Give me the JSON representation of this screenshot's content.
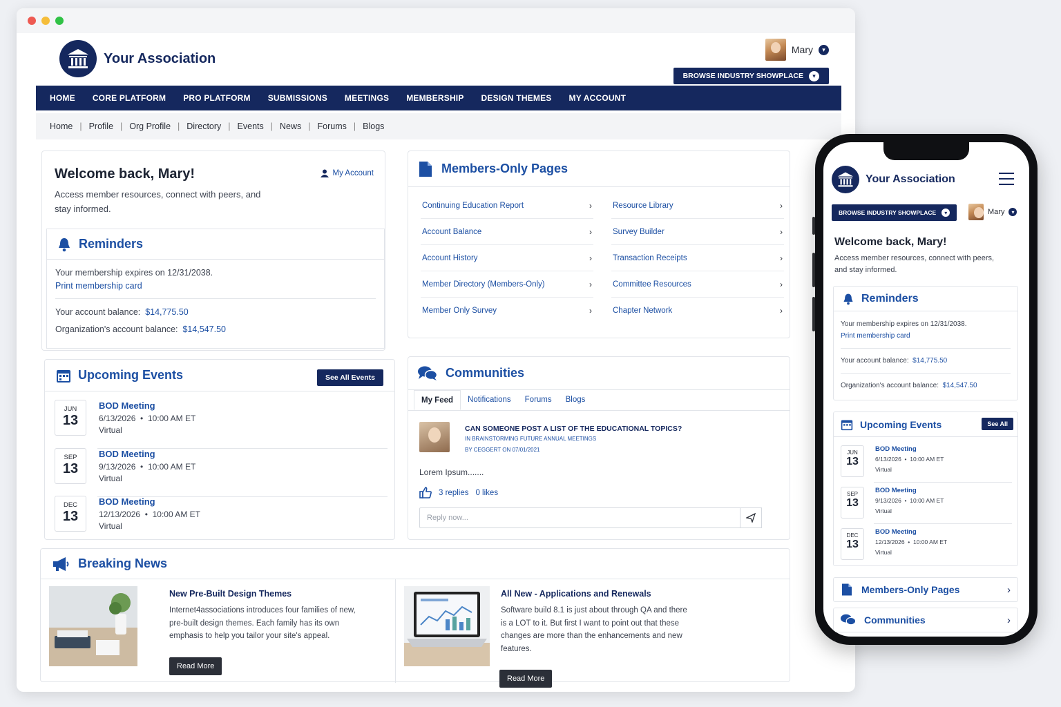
{
  "site": {
    "name": "Your Association"
  },
  "user": {
    "name": "Mary"
  },
  "showplace_label": "BROWSE INDUSTRY SHOWPLACE",
  "mainnav": [
    "HOME",
    "CORE PLATFORM",
    "PRO PLATFORM",
    "SUBMISSIONS",
    "MEETINGS",
    "MEMBERSHIP",
    "DESIGN THEMES",
    "MY ACCOUNT"
  ],
  "subnav": [
    "Home",
    "Profile",
    "Org Profile",
    "Directory",
    "Events",
    "News",
    "Forums",
    "Blogs"
  ],
  "welcome": {
    "title": "Welcome back, Mary!",
    "my_account": "My Account",
    "text": "Access member resources, connect with peers, and stay informed."
  },
  "reminders": {
    "title": "Reminders",
    "expires": "Your membership expires on 12/31/2038.",
    "print_card": "Print membership card",
    "balance_label": "Your account balance:",
    "balance": "$14,775.50",
    "org_balance_label": "Organization's account balance:",
    "org_balance": "$14,547.50"
  },
  "events": {
    "title": "Upcoming Events",
    "see_all": "See All Events",
    "see_all_short": "See All",
    "items": [
      {
        "month": "JUN",
        "day": "13",
        "title": "BOD Meeting",
        "date": "6/13/2026",
        "time": "10:00 AM ET",
        "location": "Virtual"
      },
      {
        "month": "SEP",
        "day": "13",
        "title": "BOD Meeting",
        "date": "9/13/2026",
        "time": "10:00 AM ET",
        "location": "Virtual"
      },
      {
        "month": "DEC",
        "day": "13",
        "title": "BOD Meeting",
        "date": "12/13/2026",
        "time": "10:00 AM ET",
        "location": "Virtual"
      }
    ]
  },
  "members_only": {
    "title": "Members-Only Pages",
    "left": [
      "Continuing Education Report",
      "Account Balance",
      "Account History",
      "Member Directory (Members-Only)",
      "Member Only Survey"
    ],
    "right": [
      "Resource Library",
      "Survey Builder",
      "Transaction Receipts",
      "Committee Resources",
      "Chapter Network"
    ]
  },
  "communities": {
    "title": "Communities",
    "tabs": [
      "My Feed",
      "Notifications",
      "Forums",
      "Blogs"
    ],
    "post_title": "CAN SOMEONE POST A LIST OF THE EDUCATIONAL TOPICS?",
    "post_in": "IN BRAINSTORMING FUTURE ANNUAL MEETINGS",
    "post_by": "BY CEGGERT ON 07/01/2021",
    "body": "Lorem Ipsum.......",
    "replies": "3 replies",
    "likes": "0 likes",
    "reply_placeholder": "Reply now..."
  },
  "news": {
    "title": "Breaking News",
    "items": [
      {
        "title": "New Pre-Built Design Themes",
        "text": "Internet4associations introduces four families of new, pre-built design themes. Each family has its own emphasis to help you tailor your site's appeal.",
        "button": "Read More"
      },
      {
        "title": "All New - Applications and Renewals",
        "text": "Software build 8.1 is just about through QA and there is a LOT to it. But first I want to point out that these changes are more than the enhancements and new features.",
        "button": "Read More"
      }
    ]
  },
  "colors": {
    "navy": "#15285e",
    "link": "#1c4fa3"
  }
}
